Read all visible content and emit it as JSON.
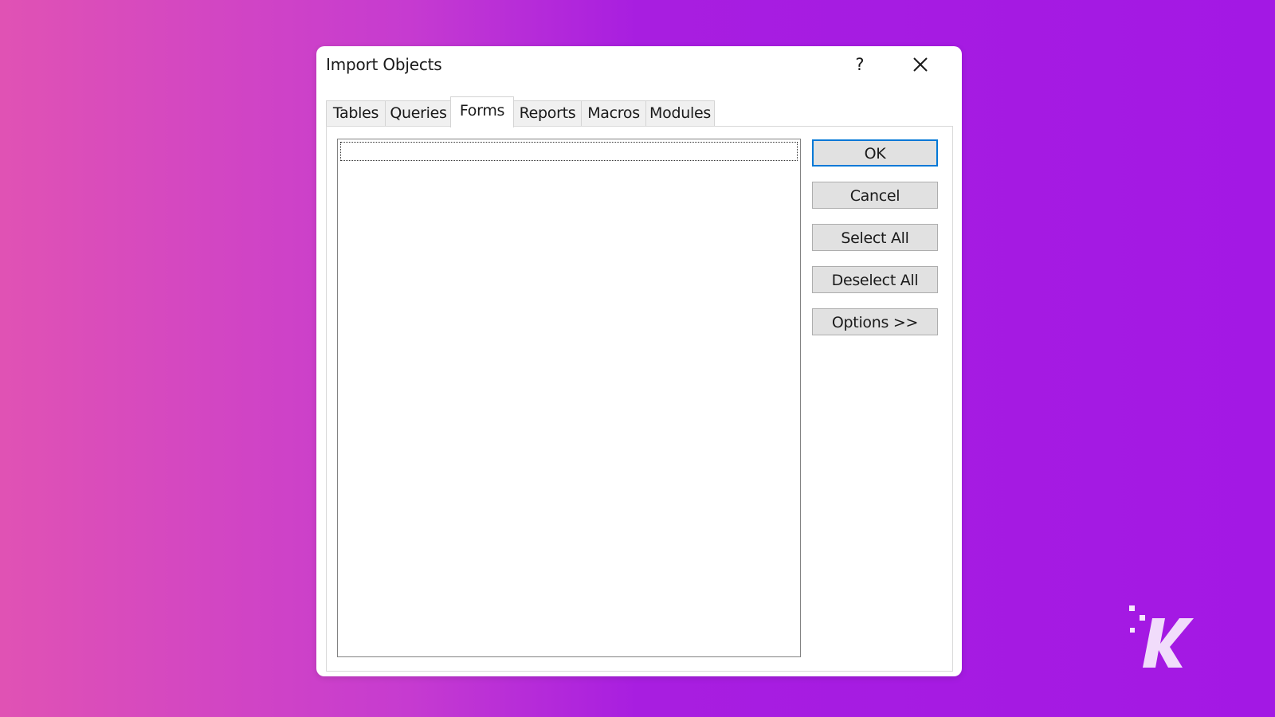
{
  "dialog": {
    "title": "Import Objects",
    "help_label": "?",
    "close_icon": "close-icon"
  },
  "tabs": [
    {
      "label": "Tables",
      "active": false
    },
    {
      "label": "Queries",
      "active": false
    },
    {
      "label": "Forms",
      "active": true
    },
    {
      "label": "Reports",
      "active": false
    },
    {
      "label": "Macros",
      "active": false
    },
    {
      "label": "Modules",
      "active": false
    }
  ],
  "buttons": {
    "ok": "OK",
    "cancel": "Cancel",
    "select_all": "Select All",
    "deselect_all": "Deselect All",
    "options": "Options >>"
  },
  "list": {
    "items": []
  },
  "colors": {
    "accent": "#0078d7",
    "background_left": "#e052b4",
    "background_right": "#a318e4"
  },
  "watermark": {
    "text": "K",
    "icon": "brand-k-logo"
  }
}
